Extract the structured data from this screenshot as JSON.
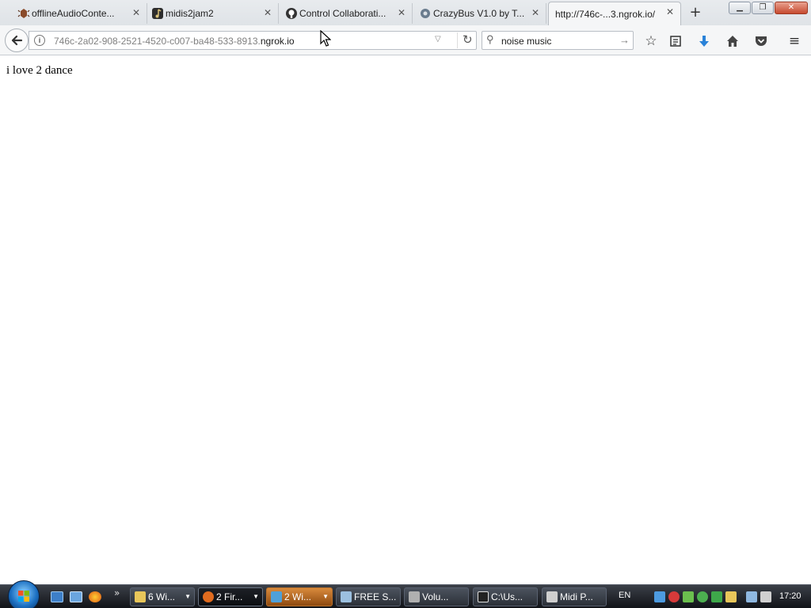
{
  "browser": {
    "tabs": [
      {
        "title": "offlineAudioConte...",
        "icon": "bug-favicon-icon",
        "color": "#8a4b2a"
      },
      {
        "title": "midis2jam2",
        "icon": "midis2jam2-favicon-icon",
        "color": "#2d2d2d"
      },
      {
        "title": "Control Collaborati...",
        "icon": "github-favicon-icon",
        "color": "#333333"
      },
      {
        "title": "CrazyBus V1.0 by T...",
        "icon": "gear-favicon-icon",
        "color": "#6a7c8e"
      },
      {
        "title": "http://746c-...3.ngrok.io/",
        "icon": "",
        "color": ""
      }
    ],
    "new_tab_label": "+",
    "window_buttons": {
      "minimize": "▁",
      "maximize": "❐",
      "close": "✕"
    },
    "address": {
      "prefix": "746c-2a02-908-2521-4520-c007-ba48-533-8913.",
      "domain": "ngrok.io"
    },
    "search": {
      "value": "noise music"
    }
  },
  "page": {
    "body_text": "i love 2 dance"
  },
  "taskbar": {
    "items": [
      {
        "label": "6 Wi...",
        "icon_color": "#e8c65a",
        "state": "normal"
      },
      {
        "label": "2 Fir...",
        "icon_color": "#e06b1f",
        "state": "active"
      },
      {
        "label": "2 Wi...",
        "icon_color": "#4fa0d8",
        "state": "highlight"
      },
      {
        "label": "FREE S...",
        "icon_color": "#9cc0e0",
        "state": "normal"
      },
      {
        "label": "Volu...",
        "icon_color": "#b0b0b0",
        "state": "normal"
      },
      {
        "label": "C:\\Us...",
        "icon_color": "#222222",
        "state": "normal"
      },
      {
        "label": "Midi P...",
        "icon_color": "#cfcfcf",
        "state": "normal"
      }
    ],
    "language": "EN",
    "clock": "17:20"
  }
}
